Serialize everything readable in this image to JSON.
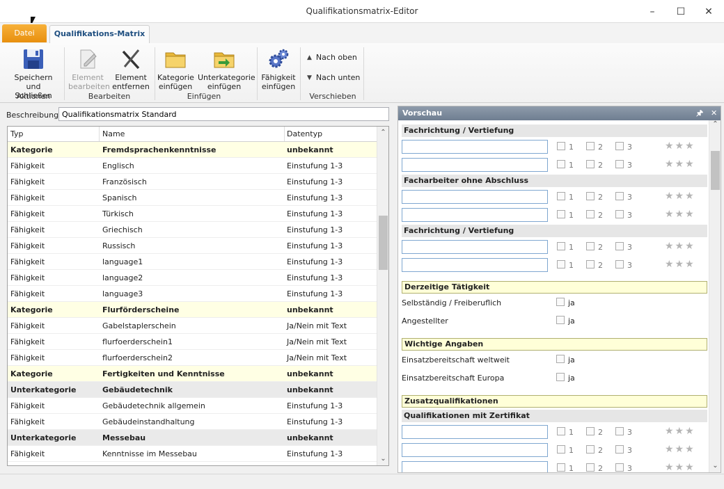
{
  "window": {
    "title": "Qualifikationsmatrix-Editor",
    "minimize": "–",
    "maximize": "☐",
    "close": "✕"
  },
  "tabs": {
    "file": "Datei",
    "main": "Qualifikations-Matrix"
  },
  "ribbon": {
    "save_line1": "Speichern und",
    "save_line2": "Schließen",
    "group_actions": "Aktionen",
    "edit_line1": "Element",
    "edit_line2": "bearbeiten",
    "remove_line1": "Element",
    "remove_line2": "entfernen",
    "group_edit": "Bearbeiten",
    "addcat_line1": "Kategorie",
    "addcat_line2": "einfügen",
    "addsub_line1": "Unterkategorie",
    "addsub_line2": "einfügen",
    "addskill_line1": "Fähigkeit",
    "addskill_line2": "einfügen",
    "group_insert": "Einfügen",
    "up": "Nach oben",
    "down": "Nach unten",
    "group_move": "Verschieben"
  },
  "description": {
    "label": "Beschreibung",
    "value": "Qualifikationsmatrix Standard"
  },
  "grid": {
    "headers": {
      "typ": "Typ",
      "name": "Name",
      "datentyp": "Datentyp"
    },
    "rows": [
      {
        "kind": "cat",
        "typ": "Kategorie",
        "name": "Fremdsprachenkenntnisse",
        "dt": "unbekannt"
      },
      {
        "kind": "item",
        "typ": "Fähigkeit",
        "name": "Englisch",
        "dt": "Einstufung 1-3"
      },
      {
        "kind": "item",
        "typ": "Fähigkeit",
        "name": "Französisch",
        "dt": "Einstufung 1-3"
      },
      {
        "kind": "item",
        "typ": "Fähigkeit",
        "name": "Spanisch",
        "dt": "Einstufung 1-3"
      },
      {
        "kind": "item",
        "typ": "Fähigkeit",
        "name": "Türkisch",
        "dt": "Einstufung 1-3"
      },
      {
        "kind": "item",
        "typ": "Fähigkeit",
        "name": "Griechisch",
        "dt": "Einstufung 1-3"
      },
      {
        "kind": "item",
        "typ": "Fähigkeit",
        "name": "Russisch",
        "dt": "Einstufung 1-3"
      },
      {
        "kind": "item",
        "typ": "Fähigkeit",
        "name": "language1",
        "dt": "Einstufung 1-3"
      },
      {
        "kind": "item",
        "typ": "Fähigkeit",
        "name": "language2",
        "dt": "Einstufung 1-3"
      },
      {
        "kind": "item",
        "typ": "Fähigkeit",
        "name": "language3",
        "dt": "Einstufung 1-3"
      },
      {
        "kind": "cat",
        "typ": "Kategorie",
        "name": "Flurförderscheine",
        "dt": "unbekannt"
      },
      {
        "kind": "item",
        "typ": "Fähigkeit",
        "name": "Gabelstaplerschein",
        "dt": "Ja/Nein mit Text"
      },
      {
        "kind": "item",
        "typ": "Fähigkeit",
        "name": "flurfoerderschein1",
        "dt": "Ja/Nein mit Text"
      },
      {
        "kind": "item",
        "typ": "Fähigkeit",
        "name": "flurfoerderschein2",
        "dt": "Ja/Nein mit Text"
      },
      {
        "kind": "cat",
        "typ": "Kategorie",
        "name": "Fertigkeiten und Kenntnisse",
        "dt": "unbekannt"
      },
      {
        "kind": "sub",
        "typ": "Unterkategorie",
        "name": "Gebäudetechnik",
        "dt": "unbekannt"
      },
      {
        "kind": "item",
        "typ": "Fähigkeit",
        "name": "Gebäudetechnik allgemein",
        "dt": "Einstufung 1-3"
      },
      {
        "kind": "item",
        "typ": "Fähigkeit",
        "name": "Gebäudeinstandhaltung",
        "dt": "Einstufung 1-3"
      },
      {
        "kind": "sub",
        "typ": "Unterkategorie",
        "name": "Messebau",
        "dt": "unbekannt"
      },
      {
        "kind": "item",
        "typ": "Fähigkeit",
        "name": "Kenntnisse im Messebau",
        "dt": "Einstufung 1-3"
      }
    ]
  },
  "preview": {
    "title": "Vorschau",
    "pin": "🖈",
    "close": "✕",
    "sec1": "Fachrichtung / Vertiefung",
    "sec2": "Facharbeiter ohne Abschluss",
    "sec3": "Fachrichtung / Vertiefung",
    "sec4": "Derzeitige Tätigkeit",
    "lbl1": "Selbständig / Freiberuflich",
    "lbl2": "Angestellter",
    "sec5": "Wichtige Angaben",
    "lbl3": "Einsatzbereitschaft weltweit",
    "lbl4": "Einsatzbereitschaft Europa",
    "sec6": "Zusatzqualifikationen",
    "sec7": "Qualifikationen mit Zertifikat",
    "opt1": "1",
    "opt2": "2",
    "opt3": "3",
    "ja": "ja"
  }
}
